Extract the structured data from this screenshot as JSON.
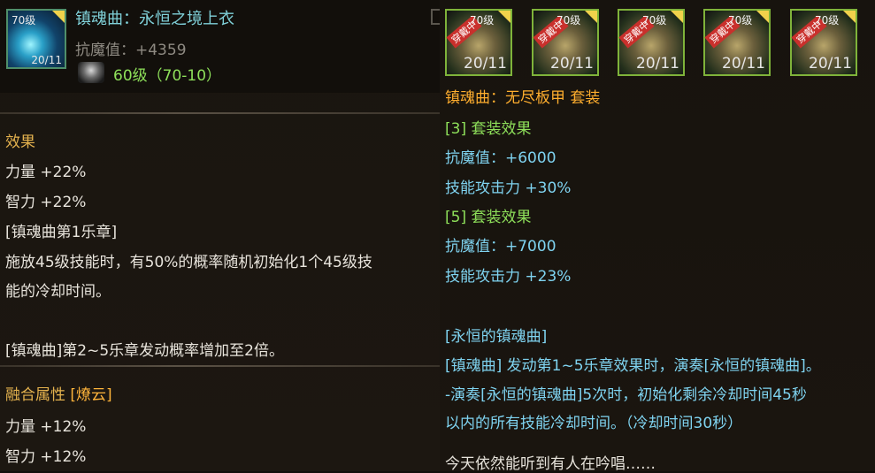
{
  "item": {
    "level_tag": "70级",
    "count": "20/11",
    "name": "镇魂曲：永恒之境上衣",
    "stat": "抗魔值：+4359",
    "level_line": "60级（70-10）",
    "icon": "sword-glow-icon"
  },
  "effects": {
    "title": "效果",
    "lines": [
      "力量 +22%",
      "智力 +22%",
      "[镇魂曲第1乐章]",
      "施放45级技能时，有50%的概率随机初始化1个45级技",
      "能的冷却时间。",
      "[镇魂曲]第2~5乐章发动概率增加至2倍。"
    ]
  },
  "fusion": {
    "label": "融合属性",
    "tag": "[燎云]",
    "lines": [
      "力量 +12%",
      "智力 +12%"
    ]
  },
  "set": {
    "pieces": [
      {
        "badge": "穿戴中",
        "tag": "70级",
        "count": "20/11",
        "icon": "armor-piece-icon"
      },
      {
        "badge": "穿戴中",
        "tag": "70级",
        "count": "20/11",
        "icon": "armor-piece-icon"
      },
      {
        "badge": "穿戴中",
        "tag": "70级",
        "count": "20/11",
        "icon": "armor-piece-icon"
      },
      {
        "badge": "穿戴中",
        "tag": "70级",
        "count": "20/11",
        "icon": "armor-piece-icon"
      },
      {
        "badge": "穿戴中",
        "tag": "70级",
        "count": "20/11",
        "icon": "armor-piece-icon"
      }
    ],
    "title": "镇魂曲：无尽板甲 套装",
    "effect3_title": "[3] 套装效果",
    "effect3_lines": [
      "抗魔值：+6000",
      "技能攻击力 +30%"
    ],
    "effect5_title": "[5] 套装效果",
    "effect5_lines": [
      "抗魔值：+7000",
      "技能攻击力 +23%"
    ],
    "eternal_title": "[永恒的镇魂曲]",
    "eternal_lines": [
      "[镇魂曲] 发动第1~5乐章效果时，演奏[永恒的镇魂曲]。",
      "-演奏[永恒的镇魂曲]5次时，初始化剩余冷却时间45秒",
      "以内的所有技能冷却时间。（冷却时间30秒）"
    ],
    "flavor": "今天依然能听到有人在吟唱……"
  }
}
